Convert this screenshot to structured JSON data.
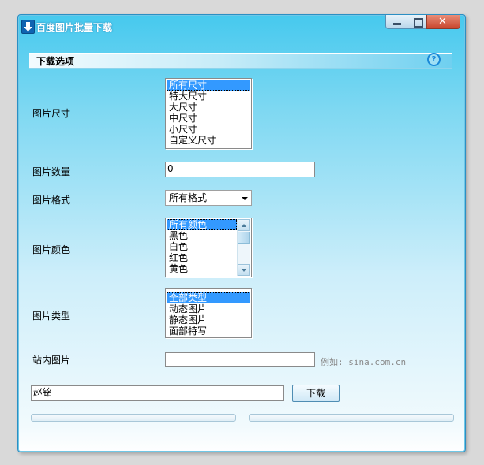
{
  "window": {
    "title": "百度图片批量下载",
    "close_glyph": "✕"
  },
  "section": {
    "title": "下载选项",
    "help_glyph": "?"
  },
  "fields": {
    "size": {
      "label": "图片尺寸",
      "options": [
        "所有尺寸",
        "特大尺寸",
        "大尺寸",
        "中尺寸",
        "小尺寸",
        "自定义尺寸"
      ],
      "selected": "所有尺寸"
    },
    "count": {
      "label": "图片数量",
      "value": "0"
    },
    "format": {
      "label": "图片格式",
      "value": "所有格式"
    },
    "color": {
      "label": "图片颜色",
      "options": [
        "所有颜色",
        "黑色",
        "白色",
        "红色",
        "黄色"
      ],
      "selected": "所有颜色"
    },
    "type": {
      "label": "图片类型",
      "options": [
        "全部类型",
        "动态图片",
        "静态图片",
        "面部特写"
      ],
      "selected": "全部类型"
    },
    "site": {
      "label": "站内图片",
      "value": "",
      "hint": "例如: sina.com.cn"
    }
  },
  "search": {
    "value": "赵铭",
    "button_label": "下载"
  },
  "progress": {
    "left_fraction": 0,
    "right_fraction": 0
  },
  "colors": {
    "title_bg": "#46c9ee",
    "selection": "#3399ff",
    "close_button": "#c8462d"
  }
}
